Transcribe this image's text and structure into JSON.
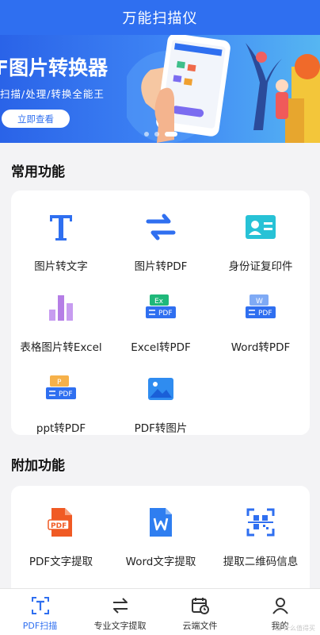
{
  "header": {
    "title": "万能扫描仪"
  },
  "banner": {
    "title": "F图片转换器",
    "subtitle": "扫描/处理/转换全能王",
    "button_label": "立即查看"
  },
  "common": {
    "title": "常用功能",
    "items": [
      {
        "label": "图片转文字",
        "icon": "text-t-icon"
      },
      {
        "label": "图片转PDF",
        "icon": "swap-arrows-icon"
      },
      {
        "label": "身份证复印件",
        "icon": "id-card-icon"
      },
      {
        "label": "表格图片转Excel",
        "icon": "bar-chart-icon"
      },
      {
        "label": "Excel转PDF",
        "icon": "excel-pdf-icon"
      },
      {
        "label": "Word转PDF",
        "icon": "word-pdf-icon"
      },
      {
        "label": "ppt转PDF",
        "icon": "ppt-pdf-icon"
      },
      {
        "label": "PDF转图片",
        "icon": "image-icon"
      }
    ]
  },
  "extra": {
    "title": "附加功能",
    "items": [
      {
        "label": "PDF文字提取",
        "icon": "pdf-doc-icon"
      },
      {
        "label": "Word文字提取",
        "icon": "word-doc-icon"
      },
      {
        "label": "提取二维码信息",
        "icon": "qr-scan-icon"
      }
    ]
  },
  "bottom_nav": [
    {
      "label": "PDF扫描",
      "icon": "scan-text-icon",
      "active": true
    },
    {
      "label": "专业文字提取",
      "icon": "exchange-icon",
      "active": false
    },
    {
      "label": "云端文件",
      "icon": "calendar-clock-icon",
      "active": false
    },
    {
      "label": "我的",
      "icon": "user-icon",
      "active": false
    }
  ],
  "watermark": "值 什么值得买",
  "colors": {
    "primary": "#2f6ff0",
    "page_bg": "#f3f3f5",
    "pdf_orange": "#f05a24",
    "purple": "#b57ee6",
    "green": "#1fb87a"
  }
}
